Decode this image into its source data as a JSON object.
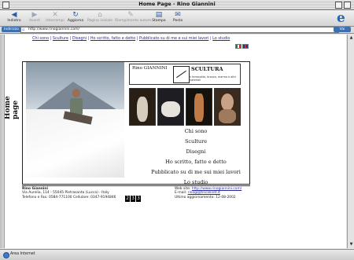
{
  "window": {
    "title": "Home Page - Rino Giannini"
  },
  "toolbar": {
    "buttons": [
      {
        "label": "Indietro",
        "icon": "back-arrow-icon",
        "enabled": true
      },
      {
        "label": "Avanti",
        "icon": "forward-arrow-icon",
        "enabled": false
      },
      {
        "label": "Interrompi",
        "icon": "stop-icon",
        "enabled": false
      },
      {
        "label": "Aggiorna",
        "icon": "refresh-icon",
        "enabled": true
      },
      {
        "label": "Pagina iniziale",
        "icon": "home-icon",
        "enabled": false
      },
      {
        "label": "Riempimento autom.",
        "icon": "autofill-icon",
        "enabled": false
      },
      {
        "label": "Stampa",
        "icon": "print-icon",
        "enabled": true
      },
      {
        "label": "Posta",
        "icon": "mail-icon",
        "enabled": true
      }
    ]
  },
  "address_bar": {
    "label": "Indirizzo",
    "url": "http://www.rinogiannini.com/",
    "go_label": "Vai"
  },
  "page": {
    "vertical_title": "Home page",
    "nav_links": [
      "Chi sono",
      "Sculture",
      "Disegni",
      "Ho scritto, fatto e detto",
      "Pubblicato su di me e sui miei lavori",
      "Lo studio"
    ],
    "logo": {
      "name": "Rino GIANNINI",
      "title": "SCULTURA",
      "subtitle": "in terracotta, bronzo, marmo e altri materiali"
    },
    "menu": [
      "Chi sono",
      "Sculture",
      "Disegni",
      "Ho scritto, fatto e detto",
      "Pubblicato su di me sui miei lavori",
      "Lo studio"
    ],
    "footer_left": {
      "name": "Rino Giannini",
      "address": "Via Aurelia, 114 - 55045 Pietrasanta (Lucca) - Italy",
      "phones": "Telefono e Fax: 0584-771100 Cellulare: 0347-9194846"
    },
    "counter_digits": [
      "2",
      "3",
      "3"
    ],
    "footer_right": {
      "web_label": "Web site:",
      "web_url": "http://www.rinogiannini.com/",
      "email_label": "E-mail:",
      "email": "rinogi@tiscalinet.it",
      "updated": "Ultimo aggiornamento: 12-08-2002"
    }
  },
  "status_bar": {
    "text": "Area Internet"
  },
  "colors": {
    "link": "#2a2aa0",
    "toolbar_icon": "#2a5da8"
  }
}
